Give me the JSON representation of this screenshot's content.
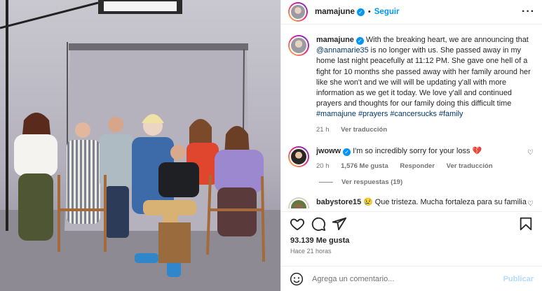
{
  "header": {
    "username": "mamajune",
    "verified": true,
    "separator": "•",
    "follow_label": "Seguir",
    "more_label": "···"
  },
  "caption": {
    "username": "mamajune",
    "text_before_mention": "With the breaking heart, we are announcing that",
    "mention": "@annamarie35",
    "text_after_mention": "is no longer with us. She passed away in my home last night peacefully at 11:12 PM. She gave one hell of a fight for 10 months she passed away with her family around her like she won't and we will will be updating y'all with more information as we get it today. We love y'all and continued prayers and thoughts for our family doing this difficult time",
    "hashtags": [
      "#mamajune",
      "#prayers",
      "#cancersucks",
      "#family"
    ],
    "time": "21 h",
    "translate_label": "Ver traducción"
  },
  "comments": [
    {
      "username": "jwoww",
      "verified": true,
      "text": "I'm so incredibly sorry for your loss 💔",
      "time": "20 h",
      "likes": "1,576 Me gusta",
      "reply_label": "Responder",
      "translate_label": "Ver traducción",
      "replies_label": "Ver respuestas (19)"
    },
    {
      "username": "babystore15",
      "verified": false,
      "text": "😢 Que tristeza. Mucha fortaleza para su familia y brille la luz perpetua para ella"
    }
  ],
  "footer": {
    "likes": "93.139 Me gusta",
    "posted_ago": "Hace 21 horas",
    "comment_placeholder": "Agrega un comentario...",
    "post_label": "Publicar"
  },
  "icons": {
    "like": "heart-icon",
    "comment": "comment-icon",
    "share": "share-icon",
    "save": "bookmark-icon",
    "emoji": "emoji-icon",
    "comment_like": "small-heart-icon"
  },
  "colors": {
    "accent": "#0095f6",
    "link": "#00376b",
    "secondary_text": "#737373",
    "post_disabled": "#b3dbff"
  }
}
